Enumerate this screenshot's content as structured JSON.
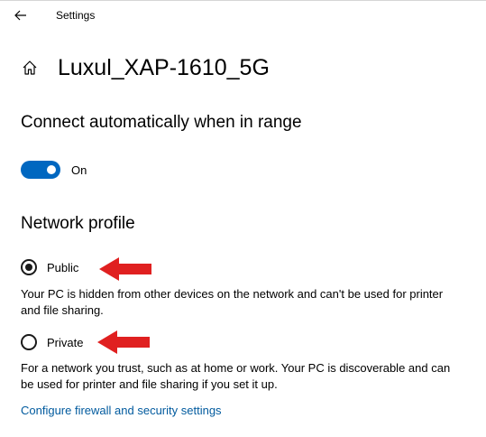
{
  "titlebar": {
    "app_title": "Settings",
    "back_icon": "back-arrow-icon"
  },
  "header": {
    "home_icon": "home-icon",
    "title": "Luxul_XAP-1610_5G"
  },
  "connect": {
    "heading": "Connect automatically when in range",
    "toggle_state": "On",
    "toggle_on": true,
    "accent_color": "#0067c0"
  },
  "network_profile": {
    "heading": "Network profile",
    "options": [
      {
        "label": "Public",
        "selected": true,
        "description": "Your PC is hidden from other devices on the network and can't be used for printer and file sharing."
      },
      {
        "label": "Private",
        "selected": false,
        "description": "For a network you trust, such as at home or work. Your PC is discoverable and can be used for printer and file sharing if you set it up."
      }
    ]
  },
  "firewall_link": "Configure firewall and security settings",
  "annotations": {
    "arrow_color": "#e02020"
  }
}
